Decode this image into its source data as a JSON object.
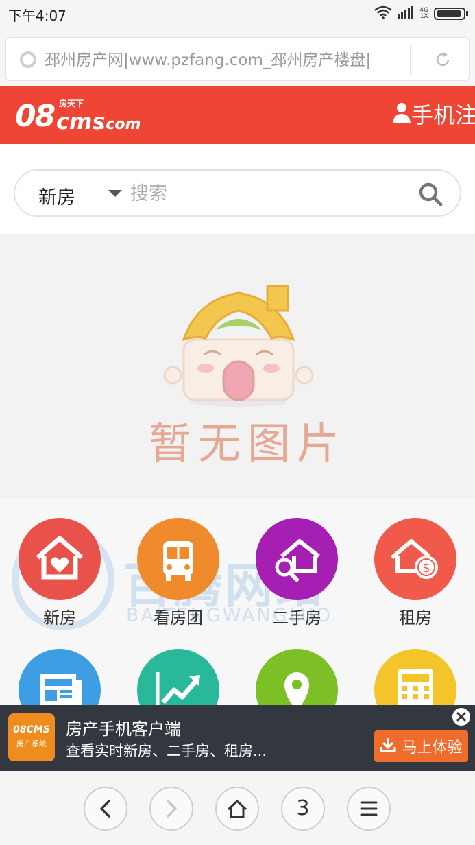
{
  "status_bar": {
    "time": "下午4:07",
    "network_top": "4G",
    "network_bottom": "1X"
  },
  "url_bar": {
    "url": "邳州房产网|www.pzfang.com_邳州房产楼盘|"
  },
  "header": {
    "logo": {
      "numerals": "08",
      "tagline": "房天下",
      "cms": "cms",
      "domain": ".com"
    },
    "register_label": "手机注册"
  },
  "search": {
    "category": "新房",
    "placeholder": "搜索"
  },
  "banner": {
    "caption": "暂无图片"
  },
  "watermark": {
    "text": "百腾网络",
    "sub": "BAITENGWANGLUO"
  },
  "nav": {
    "items": [
      {
        "label": "新房",
        "color": "#e9524a",
        "icon": "house-heart-icon"
      },
      {
        "label": "看房团",
        "color": "#ef8b2c",
        "icon": "bus-icon"
      },
      {
        "label": "二手房",
        "color": "#a51fb3",
        "icon": "house-search-icon"
      },
      {
        "label": "租房",
        "color": "#f05a4a",
        "icon": "house-coin-icon"
      },
      {
        "label": "",
        "color": "#3d9ee4",
        "icon": "newspaper-icon"
      },
      {
        "label": "",
        "color": "#28b99a",
        "icon": "trend-chart-icon"
      },
      {
        "label": "",
        "color": "#7dbf26",
        "icon": "map-pin-icon"
      },
      {
        "label": "",
        "color": "#f4c42b",
        "icon": "calculator-icon"
      }
    ]
  },
  "promo": {
    "logo_top": "08CMS",
    "logo_bottom": "房产系统",
    "title": "房产手机客户端",
    "description": "查看实时新房、二手房、租房...",
    "cta_label": "马上体验"
  },
  "bottom_bar": {
    "tab_count": "3"
  },
  "colors": {
    "brand_red": "#ef4535",
    "cta_orange": "#ef6c2d",
    "promo_bg": "#2a2f3a"
  }
}
